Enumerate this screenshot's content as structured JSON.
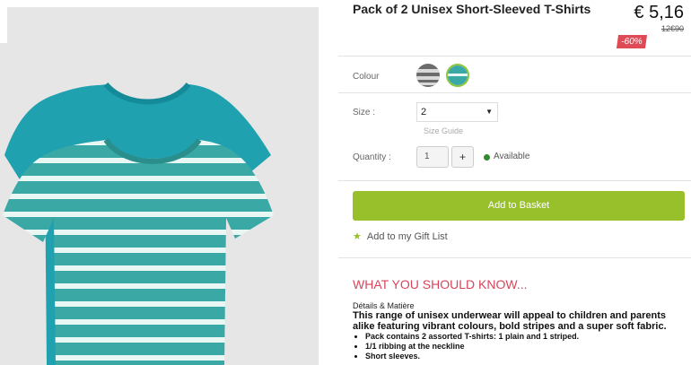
{
  "product": {
    "title": "Pack of 2 Unisex Short-Sleeved T-Shirts",
    "price": "€ 5,16",
    "old_price": "12€90",
    "discount": "-60%"
  },
  "options": {
    "colour_label": "Colour",
    "size_label": "Size :",
    "size_value": "2",
    "size_guide": "Size Guide",
    "quantity_label": "Quantity :",
    "quantity_value": "1",
    "plus_label": "+",
    "availability": "Available",
    "colors": {
      "available": "#2e8b2e",
      "accent": "#97c02b",
      "discount": "#e04a55",
      "heading": "#d7455b"
    }
  },
  "actions": {
    "add_to_basket": "Add to Basket",
    "gift_list": "Add to my Gift List"
  },
  "info": {
    "heading": "WHAT YOU SHOULD KNOW...",
    "subheading": "Détails & Matière",
    "description": "This range of unisex underwear will appeal to children and parents alike featuring vibrant colours, bold stripes and a super soft fabric.",
    "bullets": [
      "Pack contains 2 assorted T-shirts: 1 plain and 1 striped.",
      "1/1 ribbing at the neckline",
      "Short sleeves."
    ]
  }
}
